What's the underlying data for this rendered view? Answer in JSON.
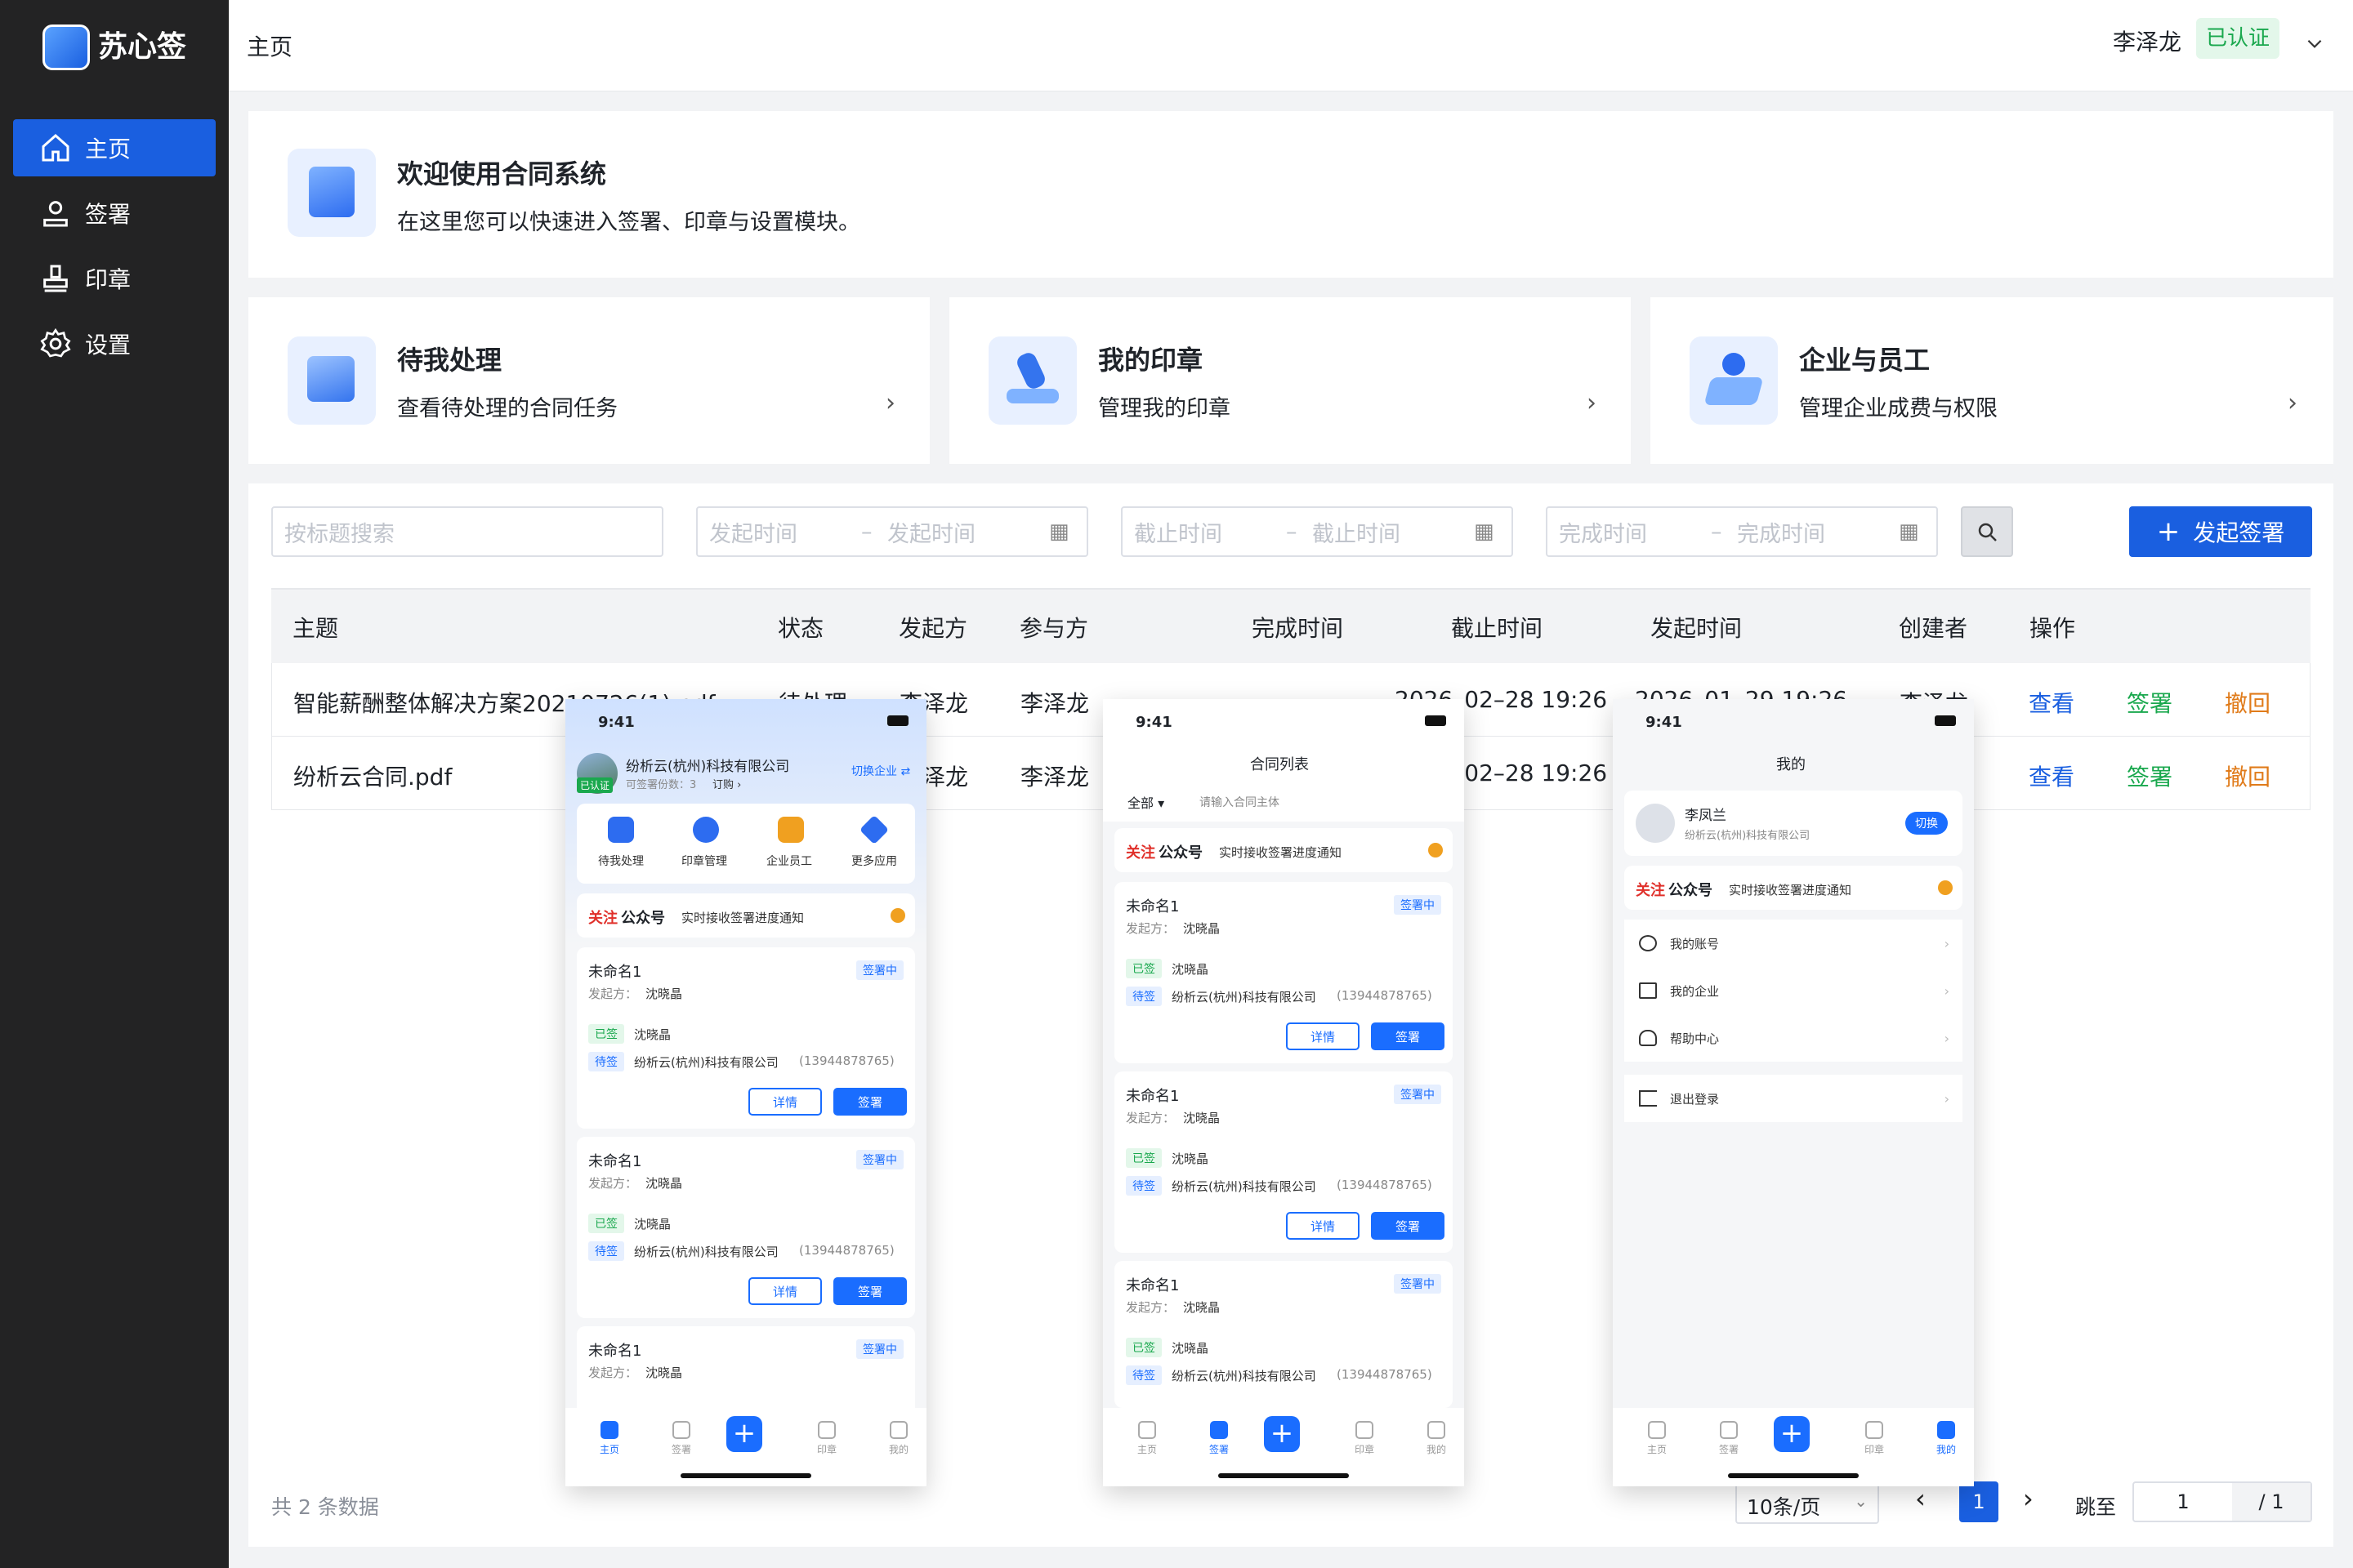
{
  "app": {
    "name": "苏心签"
  },
  "sidebar": {
    "items": [
      {
        "label": "主页",
        "icon": "home-icon",
        "active": true
      },
      {
        "label": "签署",
        "icon": "stamp-person-icon"
      },
      {
        "label": "印章",
        "icon": "seal-icon"
      },
      {
        "label": "设置",
        "icon": "gear-icon"
      }
    ]
  },
  "header": {
    "breadcrumb": "主页",
    "user": "李泽龙",
    "verified": "已认证"
  },
  "welcome": {
    "title": "欢迎使用合同系统",
    "subtitle": "在这里您可以快速进入签署、印章与设置模块。"
  },
  "quick_cards": [
    {
      "title": "待我处理",
      "subtitle": "查看待处理的合同任务"
    },
    {
      "title": "我的印章",
      "subtitle": "管理我的印章"
    },
    {
      "title": "企业与员工",
      "subtitle": "管理企业成费与权限"
    }
  ],
  "filters": {
    "search_placeholder": "按标题搜索",
    "start_from": "发起时间",
    "start_to": "发起时间",
    "deadline_from": "截止时间",
    "deadline_to": "截止时间",
    "done_from": "完成时间",
    "done_to": "完成时间",
    "range_sep": "–",
    "create_button": "发起签署"
  },
  "table": {
    "headers": [
      "主题",
      "状态",
      "发起方",
      "参与方",
      "完成时间",
      "截止时间",
      "发起时间",
      "创建者",
      "操作"
    ],
    "rows": [
      {
        "subject": "智能薪酬整体解决方案20210726(1).pdf",
        "status": "待处理",
        "initiator": "李泽龙",
        "participant": "李泽龙",
        "done": "",
        "deadline": "2026–02–28 19:26",
        "started": "2026–01–29 19:26",
        "creator": "李泽龙",
        "actions": [
          "查看",
          "签署",
          "撤回"
        ]
      },
      {
        "subject": "纷析云合同.pdf",
        "status": "",
        "initiator": "李泽龙",
        "participant": "李泽龙",
        "done": "",
        "deadline": "2026–02–28 19:26",
        "started": "",
        "creator": "",
        "actions": [
          "查看",
          "签署",
          "撤回"
        ]
      }
    ]
  },
  "pagination": {
    "total": "共 2 条数据",
    "page_size": "10条/页",
    "current": "1",
    "jump_label": "跳至",
    "jump_value": "1",
    "pages": "/ 1"
  },
  "phones": {
    "time": "9:41",
    "home": {
      "company": "纷析云(杭州)科技有限公司",
      "badge": "已认证",
      "switch": "切换企业 ⇄",
      "quota": "可签署份数：3",
      "order": "订购 ›",
      "apps": [
        "待我处理",
        "印章管理",
        "企业员工",
        "更多应用"
      ],
      "notice_red": "关注",
      "notice_black": "公众号",
      "notice_text": "实时接收签署进度通知"
    },
    "list": {
      "title": "合同列表",
      "filter": "全部 ▾",
      "search": "请输入合同主体"
    },
    "contract": {
      "name": "未命名1",
      "status": "签署中",
      "from_label": "发起方：",
      "from": "沈晓晶",
      "signed_tag": "已签",
      "signed": "沈晓晶",
      "pending_tag": "待签",
      "pending": "纷析云(杭州)科技有限公司",
      "phone": "(13944878765)",
      "detail": "详情",
      "sign": "签署"
    },
    "mine": {
      "title": "我的",
      "name": "李凤兰",
      "company": "纷析云(杭州)科技有限公司",
      "switch": "切换",
      "menu": [
        "我的账号",
        "我的企业",
        "帮助中心"
      ],
      "logout": "退出登录"
    },
    "tabs": [
      "主页",
      "签署",
      "印章",
      "我的"
    ]
  },
  "colors": {
    "brand": "#1a5fe0",
    "view": "#1a5fe0",
    "sign": "#1aa84e",
    "revoke": "#e07b1a",
    "verified_bg": "#e3f7ea"
  }
}
